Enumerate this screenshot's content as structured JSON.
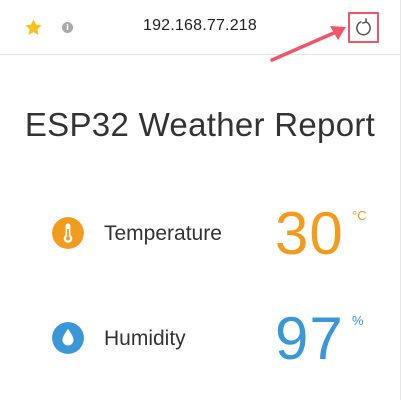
{
  "browser": {
    "url": "192.168.77.218",
    "info_icon_glyph": "i",
    "icons": {
      "bookmark": "star-icon",
      "site_info": "info-icon",
      "reload": "reload-icon"
    },
    "colors": {
      "star": "#f7c21b",
      "reload_highlight": "#f0556a"
    }
  },
  "main": {
    "title": "ESP32 Weather Report",
    "readings": [
      {
        "label": "Temperature",
        "value": "30",
        "unit": "°C",
        "icon": "thermometer-icon",
        "color": "#f29c1f"
      },
      {
        "label": "Humidity",
        "value": "97",
        "unit": "%",
        "icon": "water-drop-icon",
        "color": "#3a98d8"
      }
    ]
  }
}
